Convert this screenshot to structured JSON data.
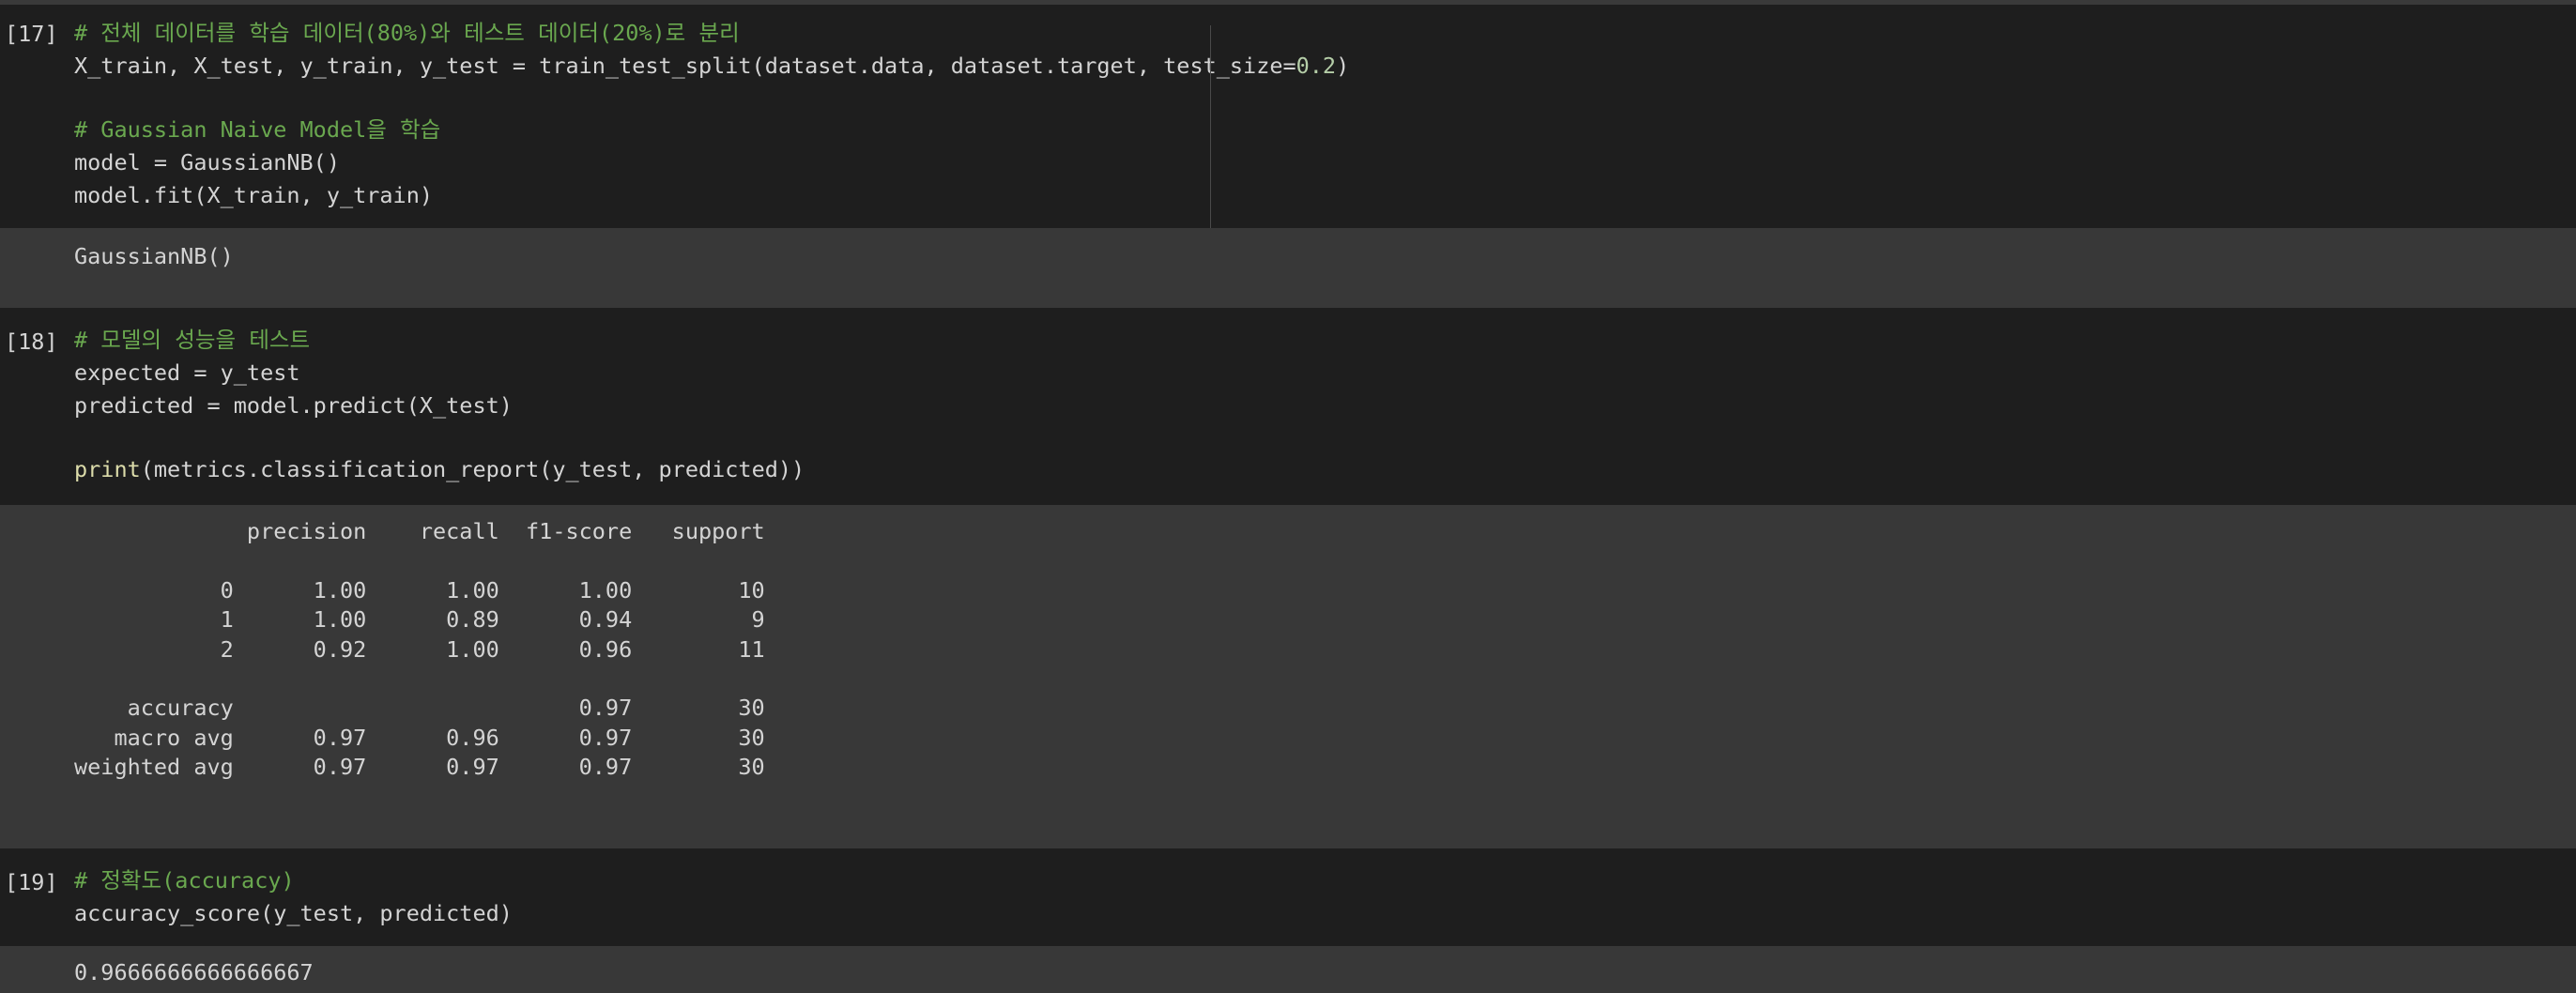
{
  "cells": [
    {
      "prompt": "[17]",
      "lines": [
        {
          "comment": "# 전체 데이터를 학습 데이터(80%)와 테스트 데이터(20%)로 분리"
        },
        {
          "code_pre": "X_train, X_test, y_train, y_test = train_test_split(dataset.data, dataset.target, test_size=",
          "num": "0.2",
          "code_post": ")"
        },
        {
          "comment": "# Gaussian Naive Model을 학습"
        },
        {
          "code": "model = GaussianNB()"
        },
        {
          "code": "model.fit(X_train, y_train)"
        }
      ],
      "output": "GaussianNB()"
    },
    {
      "prompt": "[18]",
      "lines": [
        {
          "comment": "# 모델의 성능을 테스트"
        },
        {
          "code": "expected = y_test"
        },
        {
          "code": "predicted = model.predict(X_test)"
        },
        {
          "builtin": "print",
          "code_post": "(metrics.classification_report(y_test, predicted))"
        }
      ],
      "report": {
        "header": [
          "",
          "precision",
          "recall",
          "f1-score",
          "support"
        ],
        "rows": [
          [
            "0",
            "1.00",
            "1.00",
            "1.00",
            "10"
          ],
          [
            "1",
            "1.00",
            "0.89",
            "0.94",
            "9"
          ],
          [
            "2",
            "0.92",
            "1.00",
            "0.96",
            "11"
          ]
        ],
        "summary": [
          [
            "accuracy",
            "",
            "",
            "0.97",
            "30"
          ],
          [
            "macro avg",
            "0.97",
            "0.96",
            "0.97",
            "30"
          ],
          [
            "weighted avg",
            "0.97",
            "0.97",
            "0.97",
            "30"
          ]
        ]
      }
    },
    {
      "prompt": "[19]",
      "lines": [
        {
          "comment": "# 정확도(accuracy)"
        },
        {
          "code": "accuracy_score(y_test, predicted)"
        }
      ],
      "output": "0.9666666666666667"
    }
  ],
  "colors": {
    "background": "#1e1e1e",
    "output_background": "#383838",
    "comment": "#6aa84f",
    "builtin": "#dcdcaa",
    "number": "#b5cea8",
    "text": "#d4d4d4"
  }
}
